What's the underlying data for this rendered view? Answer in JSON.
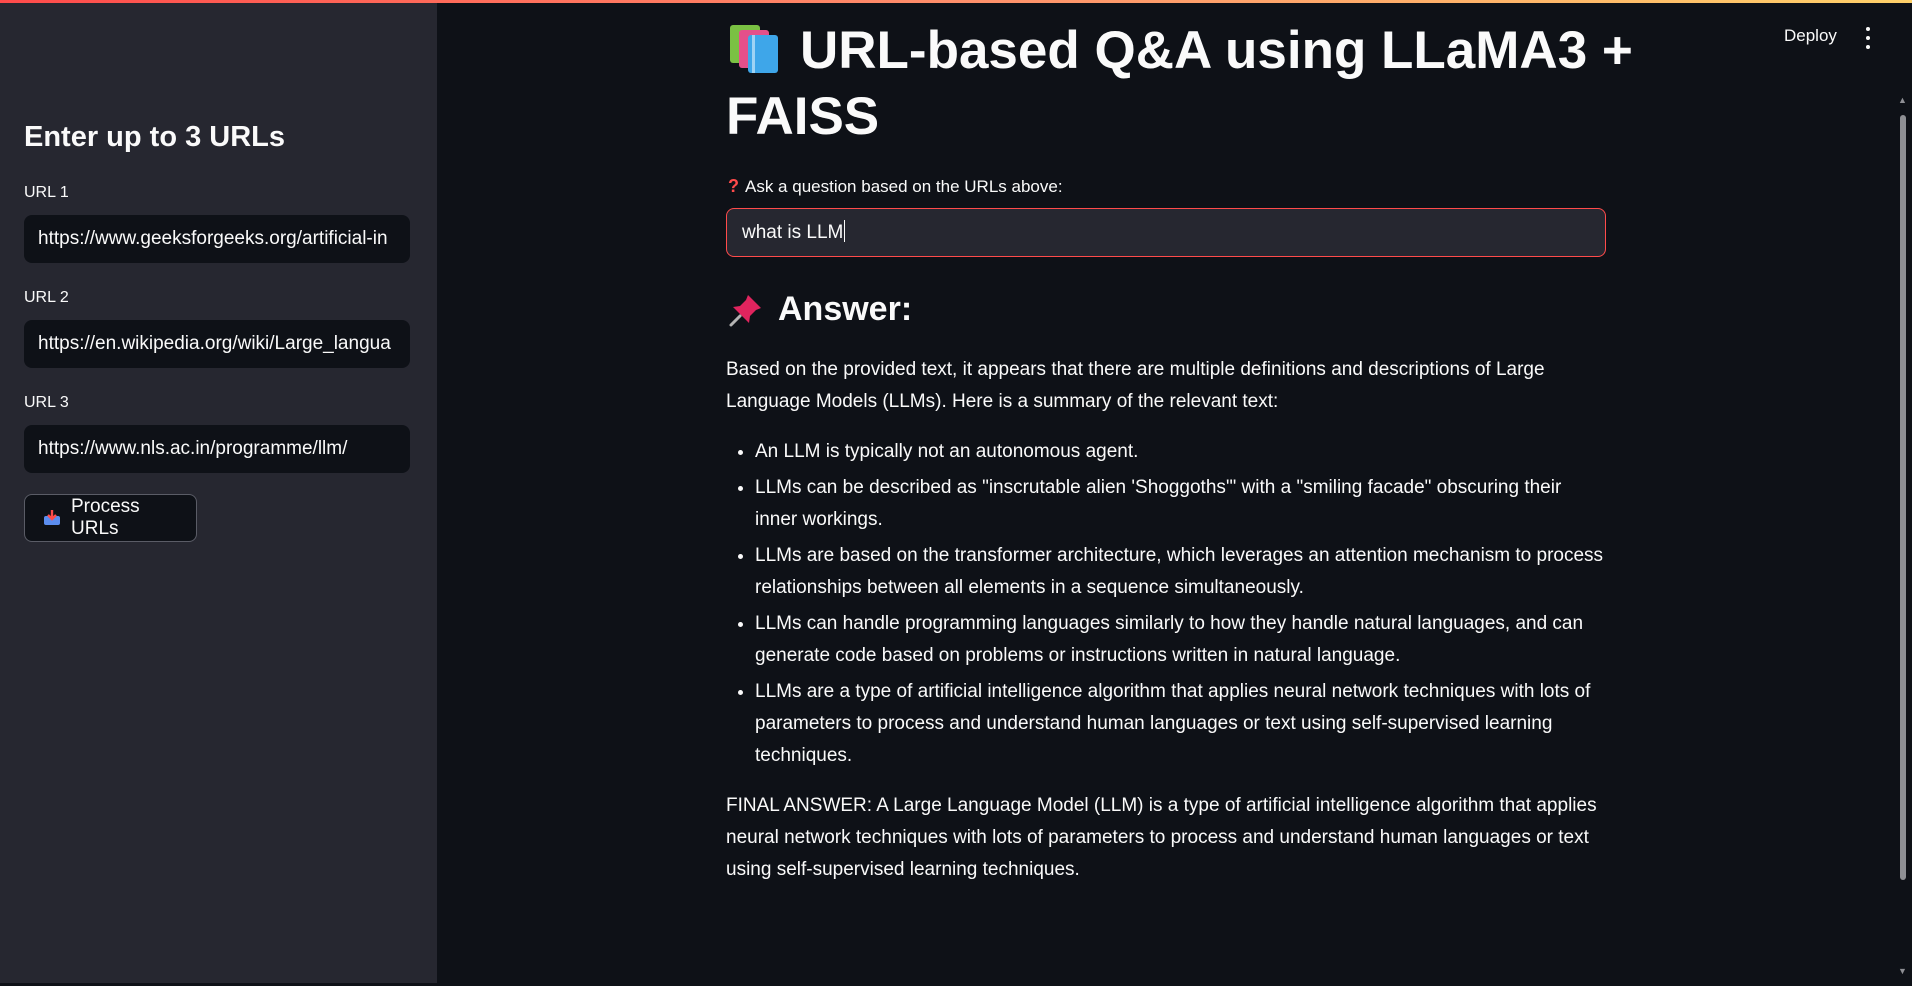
{
  "sidebar": {
    "heading": "Enter up to 3 URLs",
    "urls": [
      {
        "label": "URL 1",
        "value": "https://www.geeksforgeeks.org/artificial-in"
      },
      {
        "label": "URL 2",
        "value": "https://en.wikipedia.org/wiki/Large_langua"
      },
      {
        "label": "URL 3",
        "value": "https://www.nls.ac.in/programme/llm/"
      }
    ],
    "process_button": "Process URLs",
    "process_icon": "inbox-tray-icon"
  },
  "header": {
    "deploy_label": "Deploy",
    "menu_icon": "more-vertical-icon"
  },
  "main": {
    "title": "URL-based Q&A using LLaMA3 + FAISS",
    "title_icon": "books-icon",
    "question_label": "Ask a question based on the URLs above:",
    "question_value": "what is LLM",
    "answer_heading": "Answer:",
    "answer_icon": "pushpin-icon",
    "intro": "Based on the provided text, it appears that there are multiple definitions and descriptions of Large Language Models (LLMs). Here is a summary of the relevant text:",
    "bullets": [
      "An LLM is typically not an autonomous agent.",
      "LLMs can be described as \"inscrutable alien 'Shoggoths'\" with a \"smiling facade\" obscuring their inner workings.",
      "LLMs are based on the transformer architecture, which leverages an attention mechanism to process relationships between all elements in a sequence simultaneously.",
      "LLMs can handle programming languages similarly to how they handle natural languages, and can generate code based on problems or instructions written in natural language.",
      "LLMs are a type of artificial intelligence algorithm that applies neural network techniques with lots of parameters to process and understand human languages or text using self-supervised learning techniques."
    ],
    "final_answer": "FINAL ANSWER: A Large Language Model (LLM) is a type of artificial intelligence algorithm that applies neural network techniques with lots of parameters to process and understand human languages or text using self-supervised learning techniques."
  },
  "colors": {
    "accent": "#ff4b4b",
    "background": "#0e1117",
    "sidebar": "#262730",
    "text": "#fafafa"
  }
}
